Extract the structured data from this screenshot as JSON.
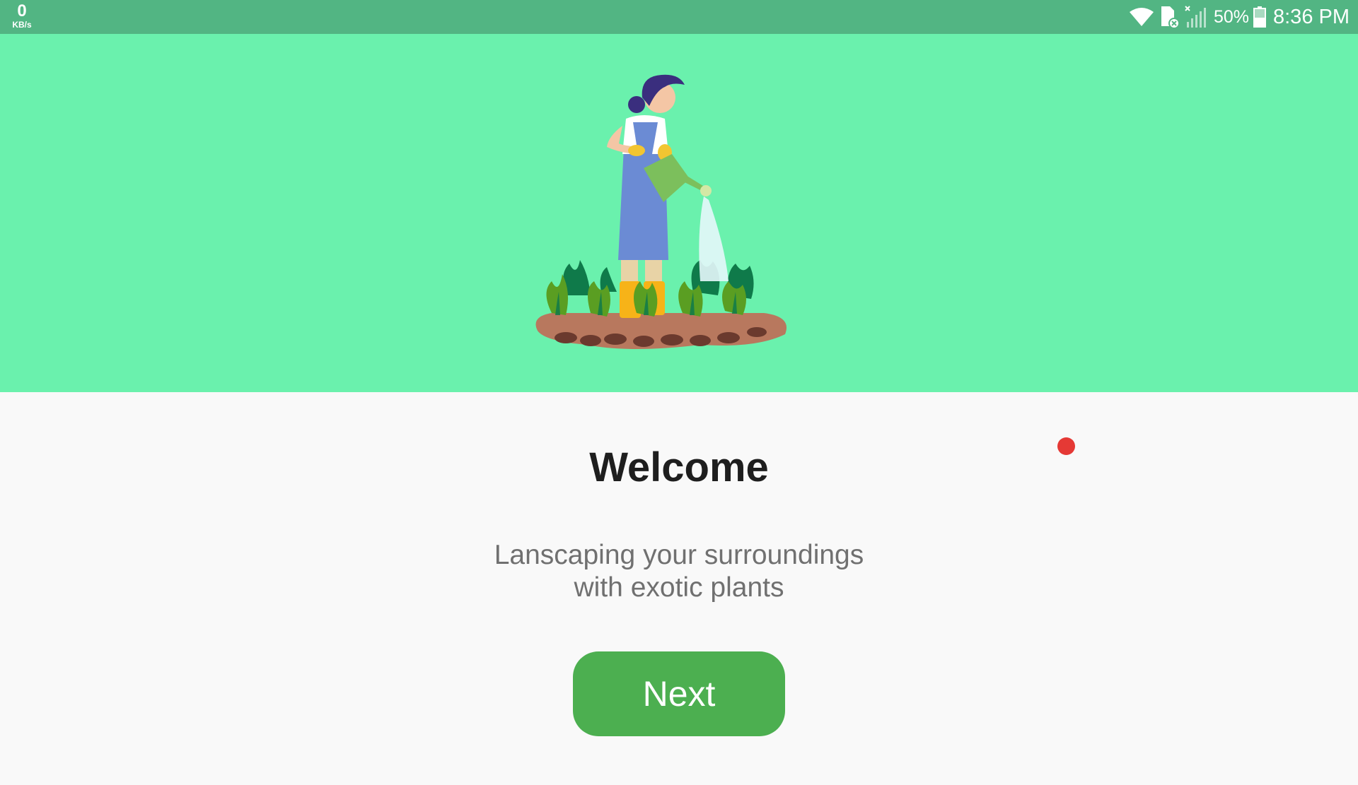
{
  "status_bar": {
    "net_speed_value": "0",
    "net_speed_unit": "KB/s",
    "battery_percent": "50%",
    "time": "8:36 PM",
    "icons": [
      "wifi-icon",
      "sim-card-icon",
      "signal-icon",
      "battery-icon"
    ]
  },
  "hero": {
    "illustration": "woman-watering-plants-illustration",
    "background_color": "#6af1ad"
  },
  "onboarding": {
    "title": "Welcome",
    "subtitle_line1": "Lanscaping your surroundings",
    "subtitle_line2": "with exotic plants",
    "next_label": "Next",
    "accent_color": "#4caf50"
  }
}
